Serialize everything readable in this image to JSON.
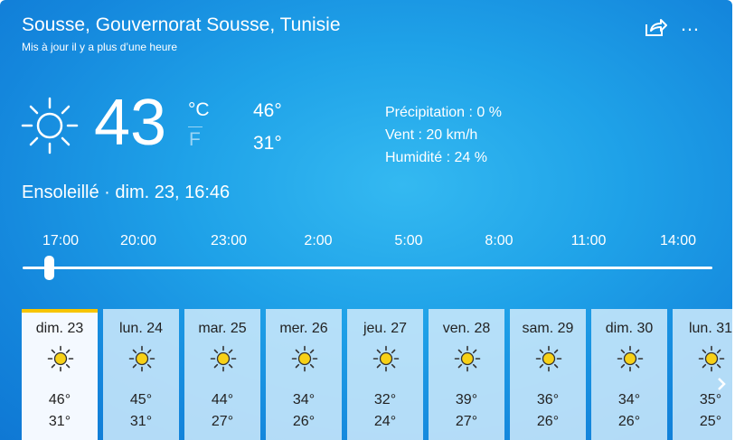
{
  "header": {
    "location": "Sousse, Gouvernorat Sousse, Tunisie",
    "updated": "Mis à jour il y a plus d’une heure",
    "share_icon": "share-icon",
    "more_label": "…"
  },
  "current": {
    "temp": "43",
    "unit_c": "°C",
    "unit_f": "F",
    "high": "46°",
    "low": "31°",
    "precipitation": "Précipitation : 0 %",
    "wind": "Vent : 20 km/h",
    "humidity": "Humidité : 24 %",
    "condition": "Ensoleillé · dim. 23, 16:46",
    "icon": "sun-icon"
  },
  "timeline": {
    "times": [
      "17:00",
      "20:00",
      "23:00",
      "2:00",
      "5:00",
      "8:00",
      "11:00",
      "14:00"
    ],
    "position": 0.03
  },
  "forecast": [
    {
      "day": "dim. 23",
      "high": "46°",
      "low": "31°"
    },
    {
      "day": "lun. 24",
      "high": "45°",
      "low": "31°"
    },
    {
      "day": "mar. 25",
      "high": "44°",
      "low": "27°"
    },
    {
      "day": "mer. 26",
      "high": "34°",
      "low": "26°"
    },
    {
      "day": "jeu. 27",
      "high": "32°",
      "low": "24°"
    },
    {
      "day": "ven. 28",
      "high": "39°",
      "low": "27°"
    },
    {
      "day": "sam. 29",
      "high": "36°",
      "low": "26°"
    },
    {
      "day": "dim. 30",
      "high": "34°",
      "low": "26°"
    },
    {
      "day": "lun. 31",
      "high": "35°",
      "low": "25°"
    }
  ],
  "colors": {
    "sun_fill": "#f7d117",
    "selected_accent": "#f7c500"
  }
}
